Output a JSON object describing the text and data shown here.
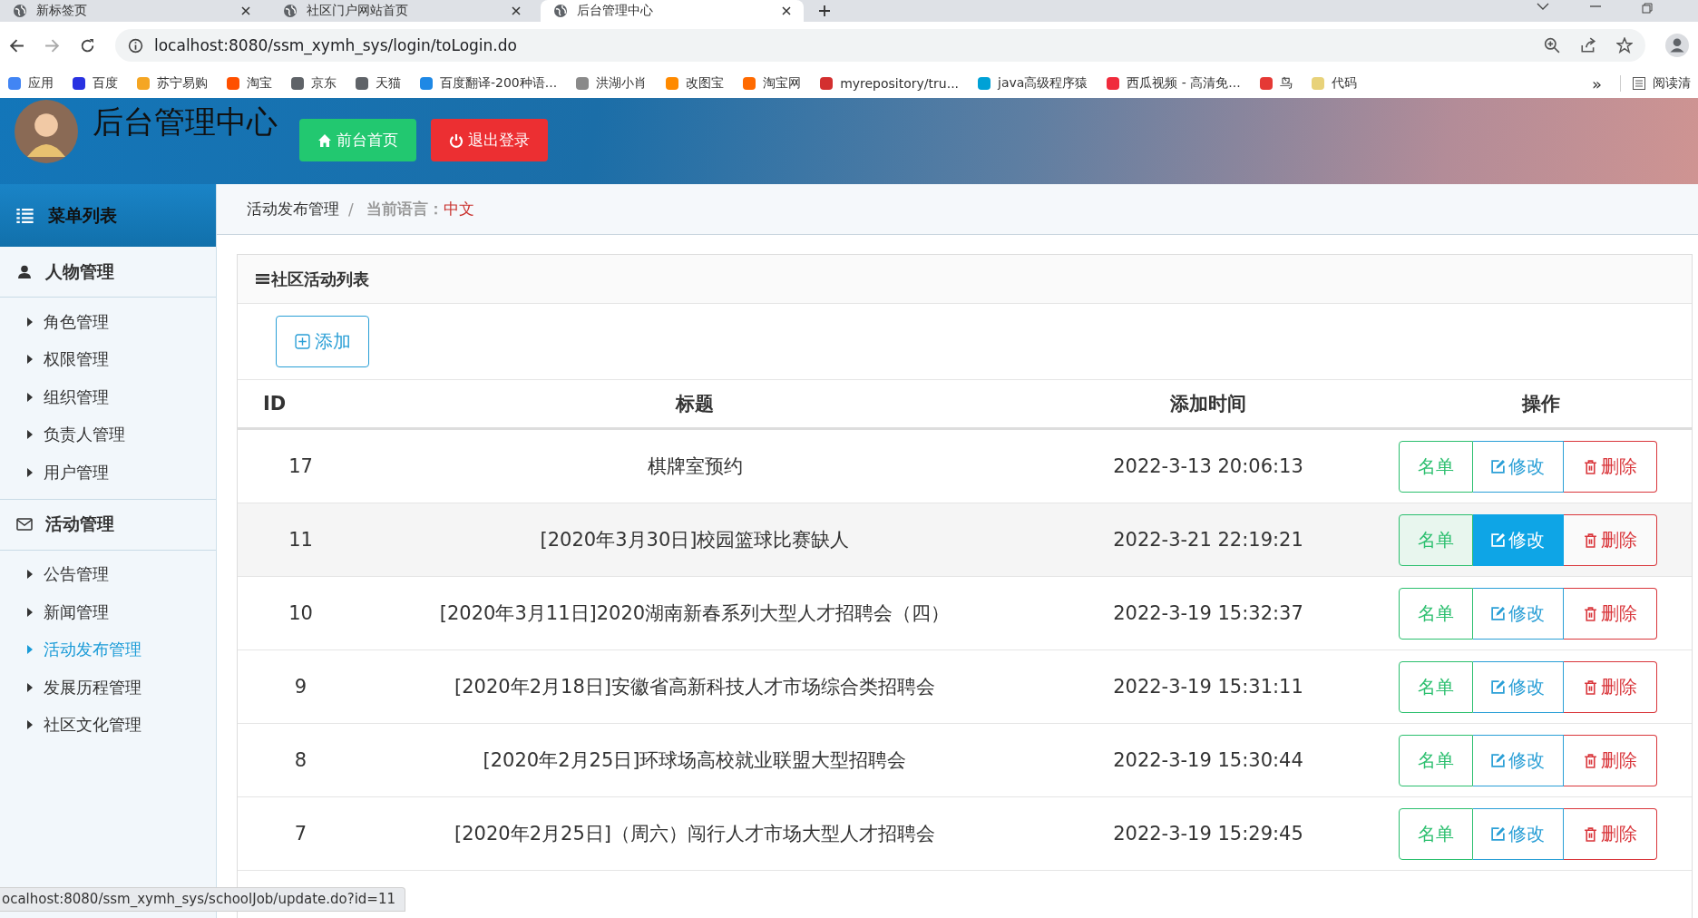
{
  "browser": {
    "tabs": [
      {
        "title": "新标签页",
        "selected": false
      },
      {
        "title": "社区门户网站首页",
        "selected": false
      },
      {
        "title": "后台管理中心",
        "selected": true
      }
    ],
    "url": "localhost:8080/ssm_xymh_sys/login/toLogin.do",
    "bookmarks": [
      {
        "label": "应用",
        "color": "#4285f4"
      },
      {
        "label": "百度",
        "color": "#2932e1"
      },
      {
        "label": "苏宁易购",
        "color": "#f5a623"
      },
      {
        "label": "淘宝",
        "color": "#ff5000"
      },
      {
        "label": "京东",
        "color": "#5f6368"
      },
      {
        "label": "天猫",
        "color": "#5f6368"
      },
      {
        "label": "百度翻译-200种语...",
        "color": "#1e88e5"
      },
      {
        "label": "洪湖小肖",
        "color": "#8a8a8a"
      },
      {
        "label": "改图宝",
        "color": "#ff8a00"
      },
      {
        "label": "淘宝网",
        "color": "#ff6a00"
      },
      {
        "label": "myrepository/tru...",
        "color": "#d32f2f"
      },
      {
        "label": "java高级程序猿",
        "color": "#00a1d6"
      },
      {
        "label": "西瓜视频 - 高清免...",
        "color": "#f02b3c"
      },
      {
        "label": "鸟",
        "color": "#e53935"
      },
      {
        "label": "代码",
        "color": "#e8d27a"
      }
    ],
    "overflow": "»",
    "reading_list": "阅读清",
    "status_url": "ocalhost:8080/ssm_xymh_sys/schoolJob/update.do?id=11"
  },
  "app": {
    "title": "后台管理中心",
    "header_buttons": [
      {
        "label": "前台首页",
        "kind": "home"
      },
      {
        "label": "退出登录",
        "kind": "logout"
      }
    ]
  },
  "sidebar": {
    "title": "菜单列表",
    "groups": [
      {
        "label": "人物管理",
        "kind": "person",
        "items": [
          {
            "label": "角色管理",
            "selected": false
          },
          {
            "label": "权限管理",
            "selected": false
          },
          {
            "label": "组织管理",
            "selected": false
          },
          {
            "label": "负责人管理",
            "selected": false
          },
          {
            "label": "用户管理",
            "selected": false
          }
        ]
      },
      {
        "label": "活动管理",
        "kind": "mail",
        "items": [
          {
            "label": "公告管理",
            "selected": false
          },
          {
            "label": "新闻管理",
            "selected": false
          },
          {
            "label": "活动发布管理",
            "selected": true
          },
          {
            "label": "发展历程管理",
            "selected": false
          },
          {
            "label": "社区文化管理",
            "selected": false
          }
        ]
      }
    ]
  },
  "breadcrumb": {
    "page": "活动发布管理",
    "separator": "/",
    "language_label": "当前语言：",
    "language": "中文"
  },
  "panel": {
    "title": "社区活动列表",
    "add_button": "添加",
    "columns": [
      "ID",
      "标题",
      "添加时间",
      "操作"
    ],
    "rows": [
      {
        "id": "17",
        "title": "棋牌室预约",
        "time": "2022-3-13 20:06:13",
        "hovered": false,
        "actions": [
          {
            "label": "名单",
            "kind": "list"
          },
          {
            "label": "修改",
            "kind": "edit"
          },
          {
            "label": "删除",
            "kind": "delete"
          }
        ]
      },
      {
        "id": "11",
        "title": "[2020年3月30日]校园篮球比赛缺人",
        "time": "2022-3-21 22:19:21",
        "hovered": true,
        "actions": [
          {
            "label": "名单",
            "kind": "list"
          },
          {
            "label": "修改",
            "kind": "edit"
          },
          {
            "label": "删除",
            "kind": "delete"
          }
        ]
      },
      {
        "id": "10",
        "title": "[2020年3月11日]2020湖南新春系列大型人才招聘会（四）",
        "time": "2022-3-19 15:32:37",
        "hovered": false,
        "actions": [
          {
            "label": "名单",
            "kind": "list"
          },
          {
            "label": "修改",
            "kind": "edit"
          },
          {
            "label": "删除",
            "kind": "delete"
          }
        ]
      },
      {
        "id": "9",
        "title": "[2020年2月18日]安徽省高新科技人才市场综合类招聘会",
        "time": "2022-3-19 15:31:11",
        "hovered": false,
        "actions": [
          {
            "label": "名单",
            "kind": "list"
          },
          {
            "label": "修改",
            "kind": "edit"
          },
          {
            "label": "删除",
            "kind": "delete"
          }
        ]
      },
      {
        "id": "8",
        "title": "[2020年2月25日]环球场高校就业联盟大型招聘会",
        "time": "2022-3-19 15:30:44",
        "hovered": false,
        "actions": [
          {
            "label": "名单",
            "kind": "list"
          },
          {
            "label": "修改",
            "kind": "edit"
          },
          {
            "label": "删除",
            "kind": "delete"
          }
        ]
      },
      {
        "id": "7",
        "title": "[2020年2月25日]（周六）闯行人才市场大型人才招聘会",
        "time": "2022-3-19 15:29:45",
        "hovered": false,
        "actions": [
          {
            "label": "名单",
            "kind": "list"
          },
          {
            "label": "修改",
            "kind": "edit"
          },
          {
            "label": "删除",
            "kind": "delete"
          }
        ]
      }
    ]
  }
}
